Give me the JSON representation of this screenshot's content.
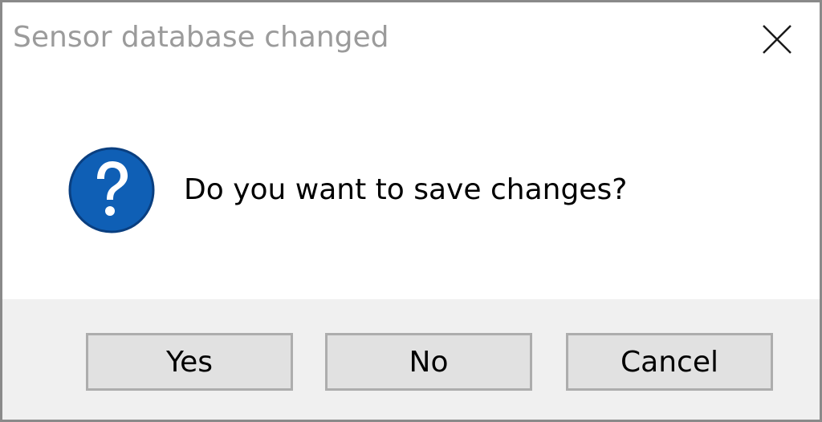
{
  "dialog": {
    "title": "Sensor database changed",
    "message": "Do you want to save changes?",
    "icon": "question-icon",
    "buttons": {
      "yes": "Yes",
      "no": "No",
      "cancel": "Cancel"
    }
  },
  "colors": {
    "title_text": "#9b9b9b",
    "footer_bg": "#f0f0f0",
    "button_bg": "#e1e1e1",
    "button_border": "#adadad",
    "icon_blue": "#0f5fb5"
  }
}
